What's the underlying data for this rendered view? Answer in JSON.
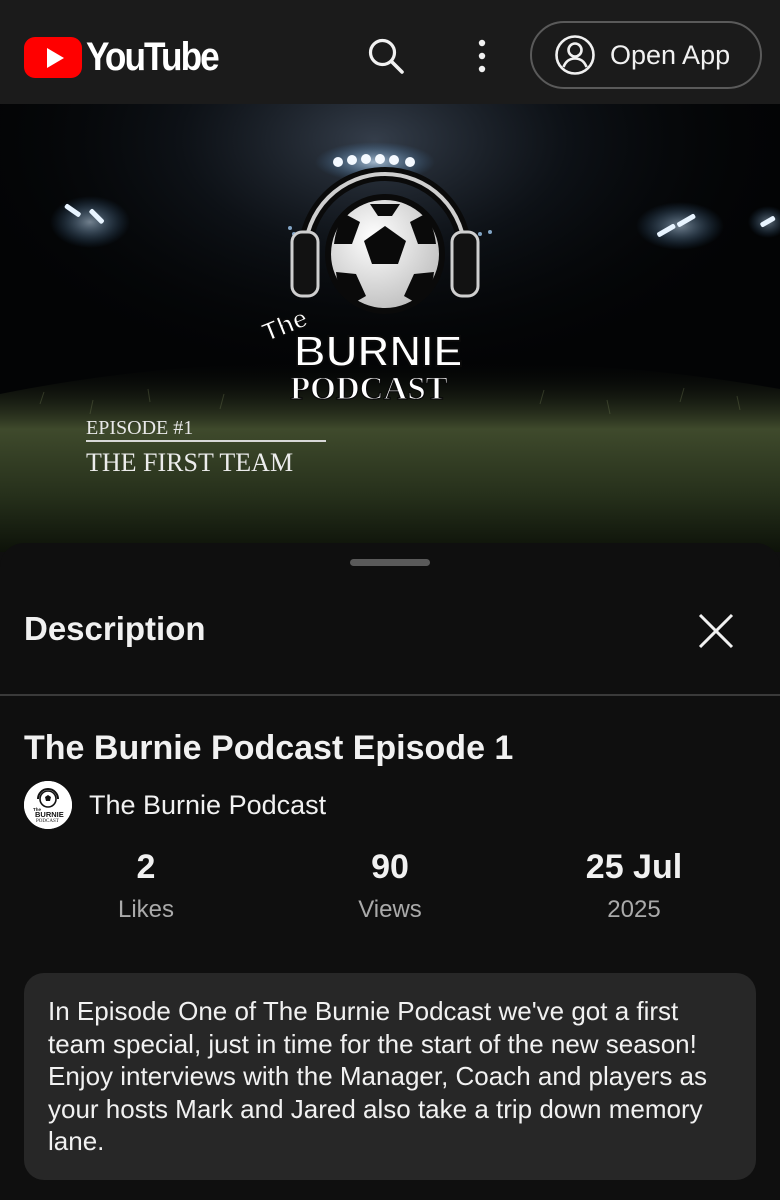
{
  "header": {
    "logo_text": "YouTube",
    "open_app_label": "Open App"
  },
  "thumbnail": {
    "logo_top_word": "The",
    "logo_main_word": "BURNIE",
    "logo_sub_word": "PODCAST",
    "episode_label": "EPISODE #1",
    "episode_title": "THE FIRST TEAM"
  },
  "description_panel": {
    "title": "Description",
    "video_title": "The Burnie Podcast Episode 1",
    "channel_name": "The Burnie Podcast",
    "avatar_lettering": [
      "The",
      "BURNIE",
      "PODCAST"
    ],
    "stats": [
      {
        "value": "2",
        "label": "Likes"
      },
      {
        "value": "90",
        "label": "Views"
      },
      {
        "value": "25 Jul",
        "label": "2025"
      }
    ],
    "description_text": "In Episode One of The Burnie Podcast we've got a first team special, just in time for the start of the new season! Enjoy interviews with the Manager, Coach and players as your hosts Mark and Jared also take a trip down memory lane."
  },
  "colors": {
    "background": "#0f0f0f",
    "header_bg": "#1b1b1b",
    "brand_red": "#ff0000",
    "description_box": "#272727",
    "secondary_text": "#aaaaaa"
  },
  "icons": [
    "youtube-play-icon",
    "search-icon",
    "more-vert-icon",
    "account-circle-icon",
    "close-icon"
  ]
}
